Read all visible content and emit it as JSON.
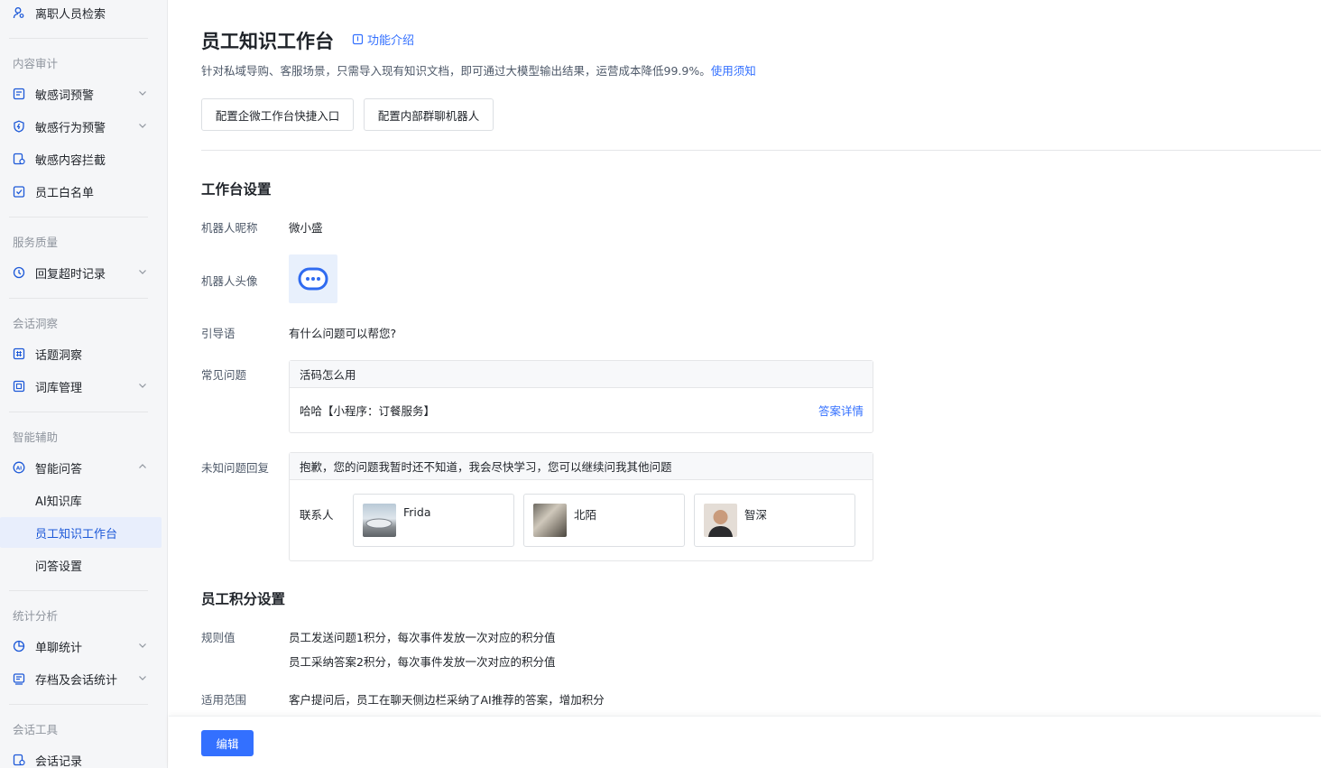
{
  "sidebar": {
    "top_item": "离职人员检索",
    "groups": {
      "content_audit": "内容审计",
      "service_quality": "服务质量",
      "session_insight": "会话洞察",
      "smart_assist": "智能辅助",
      "stats": "统计分析",
      "session_tools": "会话工具"
    },
    "items": {
      "sensitive_word": "敏感词预警",
      "sensitive_behavior": "敏感行为预警",
      "sensitive_content": "敏感内容拦截",
      "whitelist": "员工白名单",
      "reply_timeout": "回复超时记录",
      "topic_insight": "话题洞察",
      "lexicon": "词库管理",
      "smart_qa": "智能问答",
      "ai_kb": "AI知识库",
      "workbench": "员工知识工作台",
      "qa_settings": "问答设置",
      "single_chat_stats": "单聊统计",
      "archive_stats": "存档及会话统计",
      "session_records": "会话记录"
    }
  },
  "header": {
    "title": "员工知识工作台",
    "intro_link": "功能介绍",
    "description": "针对私域导购、客服场景，只需导入现有知识文档，即可通过大模型输出结果，运营成本降低99.9%。",
    "usage_link": "使用须知",
    "btn_wecom_entry": "配置企微工作台快捷入口",
    "btn_group_bot": "配置内部群聊机器人"
  },
  "workbench_settings": {
    "section_title": "工作台设置",
    "nickname_label": "机器人昵称",
    "nickname_value": "微小盛",
    "avatar_label": "机器人头像",
    "guide_label": "引导语",
    "guide_value": "有什么问题可以帮您?",
    "faq_label": "常见问题",
    "faq_question": "活码怎么用",
    "faq_answer": "哈哈【小程序：订餐服务】",
    "faq_detail_link": "答案详情",
    "unknown_label": "未知问题回复",
    "unknown_reply": "抱歉，您的问题我暂时还不知道，我会尽快学习，您可以继续问我其他问题",
    "contacts_label": "联系人",
    "contacts": [
      "Frida",
      "北陌",
      "智深"
    ]
  },
  "points_settings": {
    "section_title": "员工积分设置",
    "rule_label": "规则值",
    "rule_1": "员工发送问题1积分，每次事件发放一次对应的积分值",
    "rule_2": "员工采纳答案2积分，每次事件发放一次对应的积分值",
    "scope_label": "适用范围",
    "scope_1": "客户提问后，员工在聊天侧边栏采纳了AI推荐的答案，增加积分"
  },
  "footer": {
    "edit_button": "编辑"
  },
  "colors": {
    "accent": "#3370ff",
    "active_bg": "#e8eefc",
    "sidebar_bg": "#f5f6f8"
  }
}
